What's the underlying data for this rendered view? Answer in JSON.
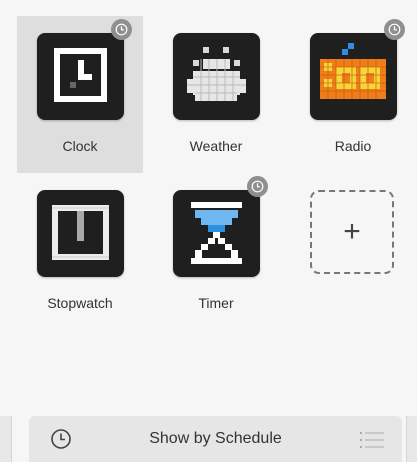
{
  "apps": [
    {
      "id": "clock",
      "label": "Clock",
      "icon": "clock-pixel-icon",
      "scheduled": true,
      "selected": true
    },
    {
      "id": "weather",
      "label": "Weather",
      "icon": "weather-pixel-icon",
      "scheduled": false,
      "selected": false
    },
    {
      "id": "radio",
      "label": "Radio",
      "icon": "radio-pixel-icon",
      "scheduled": true,
      "selected": false
    },
    {
      "id": "stopwatch",
      "label": "Stopwatch",
      "icon": "stopwatch-pixel-icon",
      "scheduled": false,
      "selected": false
    },
    {
      "id": "timer",
      "label": "Timer",
      "icon": "timer-pixel-icon",
      "scheduled": true,
      "selected": false
    }
  ],
  "add_slot": {
    "symbol": "+",
    "icon": "plus-icon"
  },
  "bottom_bar": {
    "label": "Show by Schedule",
    "left_icon": "clock-outline-icon",
    "right_icon": "list-icon"
  },
  "colors": {
    "selected_tile": "#dedede",
    "icon_bg": "#1f1f1f",
    "schedule_badge": "#8f8f8f",
    "radio_orange": "#ef7d1a",
    "radio_yellow": "#f6d63a",
    "timer_blue": "#2f8fe0"
  }
}
